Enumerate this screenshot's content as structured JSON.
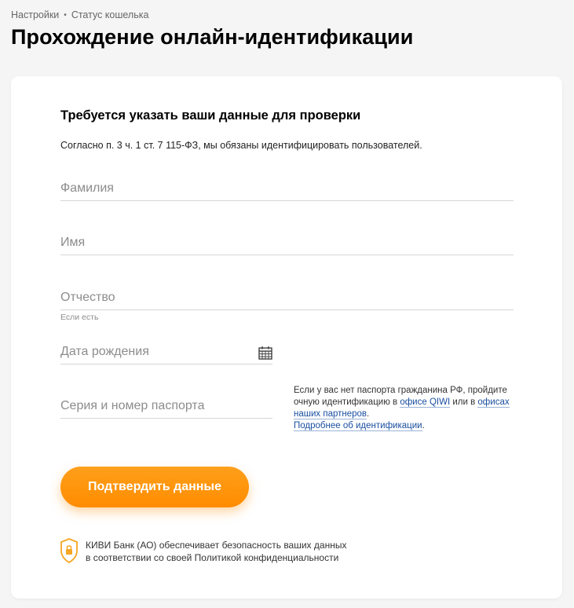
{
  "breadcrumb": {
    "items": [
      "Настройки",
      "Статус кошелька"
    ],
    "separator": "•"
  },
  "page": {
    "title": "Прохождение онлайн-идентификации"
  },
  "form": {
    "title": "Требуется указать ваши данные для проверки",
    "subtitle": "Согласно п. 3 ч. 1 ст. 7 115-ФЗ, мы обязаны идентифицировать пользователей.",
    "fields": {
      "surname": {
        "placeholder": "Фамилия",
        "value": ""
      },
      "name": {
        "placeholder": "Имя",
        "value": ""
      },
      "patronymic": {
        "placeholder": "Отчество",
        "value": "",
        "hint": "Если есть"
      },
      "birthdate": {
        "placeholder": "Дата рождения",
        "value": "",
        "icon": "calendar-icon"
      },
      "passport": {
        "placeholder": "Серия и номер паспорта",
        "value": ""
      }
    },
    "passport_note": {
      "text_1": "Если у вас нет паспорта гражданина РФ, пройдите очную идентификацию в ",
      "link_qiwi_office": "офисе QIWI",
      "text_2": " или в ",
      "link_partner_offices": "офисах наших партнеров",
      "text_3": ".",
      "link_more": "Подробнее об идентификации",
      "text_4": "."
    },
    "submit_label": "Подтвердить данные",
    "security": {
      "icon": "shield-lock-icon",
      "line_1": "КИВИ Банк (АО) обеспечивает безопасность ваших данных",
      "line_2": "в соответствии со своей Политикой конфиденциальности"
    }
  },
  "colors": {
    "accent": "#ff8c00",
    "link": "#1a4fa0",
    "background": "#f5f5f5",
    "card": "#ffffff"
  }
}
